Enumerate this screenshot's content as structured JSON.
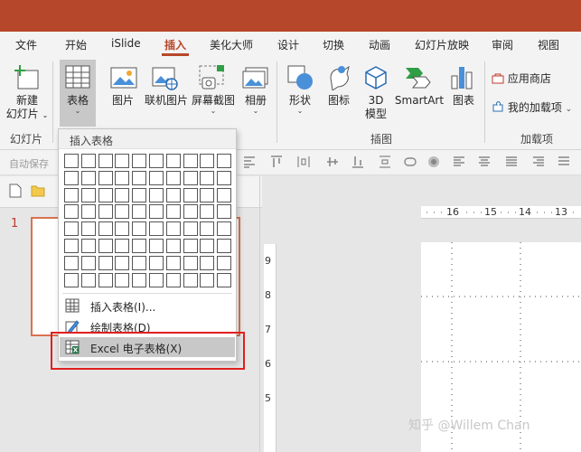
{
  "tabs": [
    "文件",
    "开始",
    "iSlide",
    "插入",
    "美化大师",
    "设计",
    "切换",
    "动画",
    "幻灯片放映",
    "审阅",
    "视图"
  ],
  "active_tab": "插入",
  "ribbon": {
    "new_slide": {
      "line1": "新建",
      "line2": "幻灯片"
    },
    "table": "表格",
    "picture": "图片",
    "online_picture": "联机图片",
    "screenshot": "屏幕截图",
    "album": "相册",
    "shapes": "形状",
    "icons": "图标",
    "model3d": {
      "line1": "3D",
      "line2": "模型"
    },
    "smartart": "SmartArt",
    "chart": "图表",
    "app_store": "应用商店",
    "my_addins": "我的加载项",
    "groups": {
      "slides": "幻灯片",
      "illustrations": "插图",
      "addins": "加载项"
    }
  },
  "quickbar": {
    "autosave": "自动保存"
  },
  "slide_panel": {
    "number": "1"
  },
  "ruler": {
    "h": [
      "16",
      "15",
      "14",
      "13"
    ],
    "v": [
      "9",
      "8",
      "7",
      "6",
      "5"
    ]
  },
  "dropdown": {
    "title": "插入表格",
    "items": [
      "插入表格(I)...",
      "绘制表格(D)",
      "Excel 电子表格(X)"
    ]
  },
  "watermark": "知乎 @Willem Chan",
  "colors": {
    "accent": "#b7472a",
    "highlight_box": "#e02020"
  }
}
